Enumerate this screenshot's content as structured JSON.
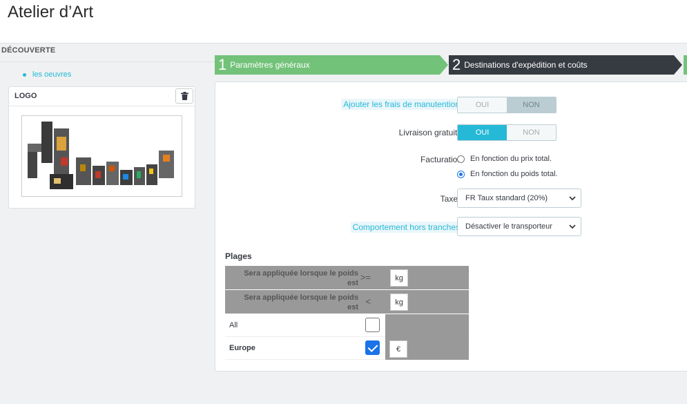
{
  "header": {
    "shop_title": "Atelier d’Art"
  },
  "breadcrumb": {
    "label": "DÉCOUVERTE"
  },
  "tree": {
    "link_label": "les oeuvres"
  },
  "logo_card": {
    "title": "LOGO",
    "delete_icon": "trash-icon"
  },
  "wizard": {
    "steps": [
      {
        "num": "1",
        "label": "Paramètres généraux",
        "state": "done"
      },
      {
        "num": "2",
        "label": "Destinations d'expédition et coûts",
        "state": "active"
      }
    ]
  },
  "form": {
    "handling": {
      "label": "Ajouter les frais de manutention",
      "yes": "OUI",
      "no": "NON",
      "value": "NON"
    },
    "free_shipping": {
      "label": "Livraison gratuite",
      "yes": "OUI",
      "no": "NON",
      "value": "OUI"
    },
    "billing": {
      "label": "Facturation",
      "options": [
        "En fonction du prix total.",
        "En fonction du poids total."
      ],
      "selected": "En fonction du poids total."
    },
    "taxes": {
      "label": "Taxes",
      "value": "FR Taux standard (20%)"
    },
    "out_of_range": {
      "label": "Comportement hors tranches",
      "value": "Désactiver le transporteur"
    }
  },
  "ranges": {
    "title": "Plages",
    "rows": [
      {
        "label": "Sera appliquée lorsque le poids est",
        "operator": ">=",
        "unit": "kg"
      },
      {
        "label": "Sera appliquée lorsque le poids est",
        "operator": "<",
        "unit": "kg"
      }
    ],
    "zones": [
      {
        "name": "All",
        "checked": false,
        "unit": ""
      },
      {
        "name": "Europe",
        "checked": true,
        "unit": "€"
      }
    ]
  },
  "colors": {
    "accent": "#25b9d7",
    "success": "#72c279",
    "dark": "#363a41"
  }
}
